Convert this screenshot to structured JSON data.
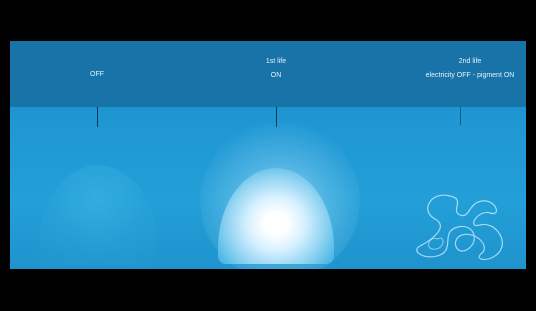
{
  "scene": {
    "states": [
      {
        "line1": "",
        "line2": "OFF"
      },
      {
        "line1": "1st life",
        "line2": "ON"
      },
      {
        "line1": "2nd life",
        "line2": "electricity OFF - pigment ON"
      }
    ]
  },
  "colors": {
    "background": "#000000",
    "header_band": "#1873a8",
    "panel": "#1f97d2",
    "label_text": "#e6f3fb",
    "glow": "#ffffff"
  },
  "icons": {
    "lamp_off": "lamp-shade-off-icon",
    "lamp_on": "lamp-shade-glowing-icon",
    "pigment": "pigment-squiggle-icon"
  }
}
